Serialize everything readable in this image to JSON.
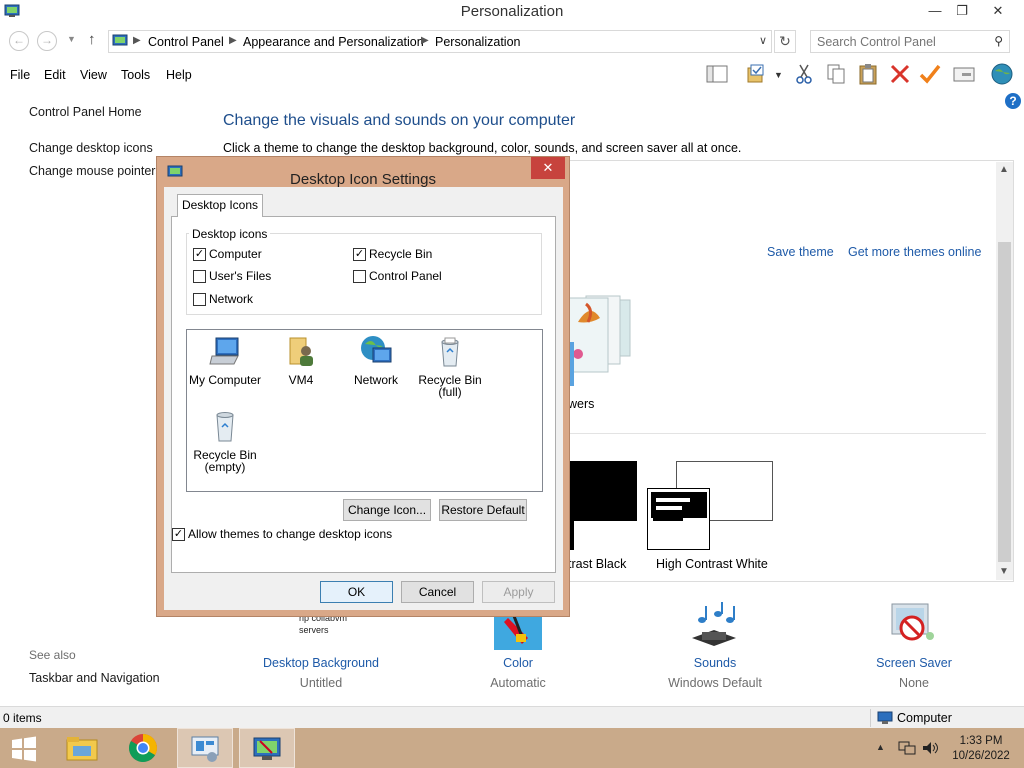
{
  "window": {
    "title": "Personalization"
  },
  "nav": {
    "breadcrumbs": [
      "Control Panel",
      "Appearance and Personalization",
      "Personalization"
    ],
    "search_placeholder": "Search Control Panel"
  },
  "menu": [
    "File",
    "Edit",
    "View",
    "Tools",
    "Help"
  ],
  "left_pane": {
    "home": "Control Panel Home",
    "links": [
      "Change desktop icons",
      "Change mouse pointers"
    ],
    "see_also_label": "See also",
    "see_also_links": [
      "Taskbar and Navigation"
    ]
  },
  "main": {
    "heading": "Change the visuals and sounds on your computer",
    "subheading": "Click a theme to change the desktop background, color, sounds, and screen saver all at once.",
    "save_theme": "Save theme",
    "get_more_themes": "Get more themes online",
    "themes": {
      "flowers_caption": "wers",
      "contrast_black_caption": "trast Black",
      "high_contrast_white": "High Contrast White"
    },
    "partial_text": [
      "rip collabvm",
      "servers"
    ],
    "settings": [
      {
        "label": "Desktop Background",
        "value": "Untitled"
      },
      {
        "label": "Color",
        "value": "Automatic"
      },
      {
        "label": "Sounds",
        "value": "Windows Default"
      },
      {
        "label": "Screen Saver",
        "value": "None"
      }
    ]
  },
  "status": {
    "items": "0 items",
    "location": "Computer"
  },
  "taskbar": {
    "time": "1:33 PM",
    "date": "10/26/2022"
  },
  "dialog": {
    "title": "Desktop Icon Settings",
    "tab": "Desktop Icons",
    "group_label": "Desktop icons",
    "checkboxes": [
      {
        "label": "Computer",
        "checked": true
      },
      {
        "label": "Recycle Bin",
        "checked": true
      },
      {
        "label": "User's Files",
        "checked": false
      },
      {
        "label": "Control Panel",
        "checked": false
      },
      {
        "label": "Network",
        "checked": false
      }
    ],
    "icons": [
      {
        "line1": "My Computer",
        "line2": ""
      },
      {
        "line1": "VM4",
        "line2": ""
      },
      {
        "line1": "Network",
        "line2": ""
      },
      {
        "line1": "Recycle Bin",
        "line2": "(full)"
      },
      {
        "line1": "Recycle Bin",
        "line2": "(empty)"
      }
    ],
    "change_icon": "Change Icon...",
    "restore_default": "Restore Default",
    "allow_themes": {
      "label": "Allow themes to change desktop icons",
      "checked": true
    },
    "ok": "OK",
    "cancel": "Cancel",
    "apply": "Apply"
  },
  "colors": {
    "taskbar": "#c9aa8a",
    "dialog_frame": "#d9a888",
    "link": "#1e5aa8",
    "heading": "#1e4e8c"
  }
}
